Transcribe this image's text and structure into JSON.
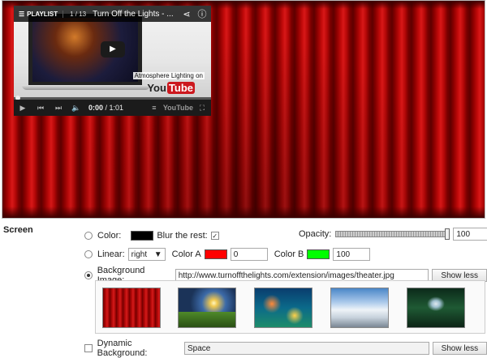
{
  "player": {
    "playlist_label": "PLAYLIST",
    "playlist_count": "1 / 13",
    "video_title": "Turn Off the Lights - ...",
    "caption": "Atmosphere Lighting on",
    "yt_logo_you": "You",
    "yt_logo_tube": "Tube",
    "time_current": "0:00",
    "time_total": " / 1:01",
    "yt_small": "YouTube",
    "progress": 0.0
  },
  "section_title": "Screen",
  "color_row": {
    "label": "Color:",
    "color": "#000000",
    "blur_label": "Blur the rest:",
    "blur_checked": true
  },
  "opacity": {
    "label": "Opacity:",
    "value": "100"
  },
  "linear_row": {
    "label": "Linear:",
    "direction": "right",
    "color_a_label": "Color A",
    "color_a": "#ff0000",
    "color_a_value": "0",
    "color_b_label": "Color B",
    "color_b": "#00ff00",
    "color_b_value": "100"
  },
  "bg_image_row": {
    "label": "Background Image:",
    "url": "http://www.turnoffthelights.com/extension/images/theater.jpg",
    "button": "Show less",
    "thumbnails": [
      "curtain",
      "landscape-sunset",
      "coral-reef",
      "snowy-mountains",
      "waterfall"
    ]
  },
  "dynamic_row": {
    "label": "Dynamic Background:",
    "value": "Space",
    "button": "Show less"
  }
}
